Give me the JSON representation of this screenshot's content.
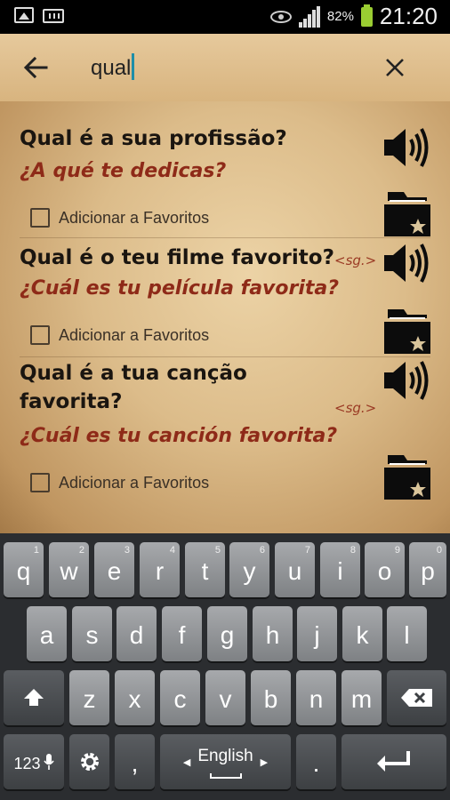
{
  "status_bar": {
    "battery": "82%",
    "time": "21:20"
  },
  "search": {
    "query": "qual"
  },
  "icons": {
    "back": "back-arrow-icon",
    "close": "close-icon",
    "speaker": "speaker-icon",
    "favorites_folder": "star-folder-icon"
  },
  "results": [
    {
      "portuguese": "Qual é a sua profissão?",
      "spanish": "¿A qué te dedicas?",
      "note": "",
      "favorite_label": "Adicionar a Favoritos"
    },
    {
      "portuguese": "Qual é o teu filme favorito?",
      "spanish": "¿Cuál es tu película favorita?",
      "note": "<sg.>",
      "favorite_label": "Adicionar a Favoritos"
    },
    {
      "portuguese_line1": "Qual é a tua canção",
      "portuguese_line2": "favorita?",
      "spanish": "¿Cuál es tu canción favorita?",
      "note": "<sg.>",
      "favorite_label": "Adicionar a Favoritos"
    }
  ],
  "keyboard": {
    "row1": [
      {
        "k": "q",
        "n": "1"
      },
      {
        "k": "w",
        "n": "2"
      },
      {
        "k": "e",
        "n": "3"
      },
      {
        "k": "r",
        "n": "4"
      },
      {
        "k": "t",
        "n": "5"
      },
      {
        "k": "y",
        "n": "6"
      },
      {
        "k": "u",
        "n": "7"
      },
      {
        "k": "i",
        "n": "8"
      },
      {
        "k": "o",
        "n": "9"
      },
      {
        "k": "p",
        "n": "0"
      }
    ],
    "row2": [
      "a",
      "s",
      "d",
      "f",
      "g",
      "h",
      "j",
      "k",
      "l"
    ],
    "row3": [
      "z",
      "x",
      "c",
      "v",
      "b",
      "n",
      "m"
    ],
    "sym_key": "123",
    "comma": ",",
    "space_label": "English",
    "period": "."
  }
}
